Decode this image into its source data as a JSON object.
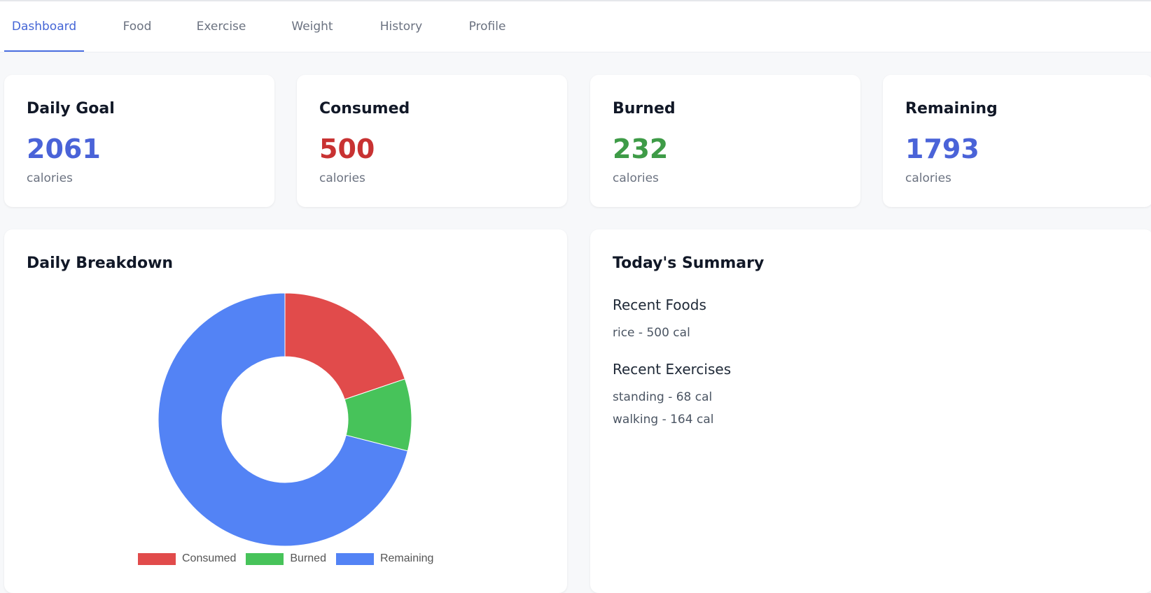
{
  "nav": {
    "tabs": [
      {
        "label": "Dashboard",
        "active": true
      },
      {
        "label": "Food",
        "active": false
      },
      {
        "label": "Exercise",
        "active": false
      },
      {
        "label": "Weight",
        "active": false
      },
      {
        "label": "History",
        "active": false
      },
      {
        "label": "Profile",
        "active": false
      }
    ]
  },
  "stats": [
    {
      "title": "Daily Goal",
      "value": "2061",
      "unit": "calories",
      "color": "#4a63d8"
    },
    {
      "title": "Consumed",
      "value": "500",
      "unit": "calories",
      "color": "#c83232"
    },
    {
      "title": "Burned",
      "value": "232",
      "unit": "calories",
      "color": "#3e9b47"
    },
    {
      "title": "Remaining",
      "value": "1793",
      "unit": "calories",
      "color": "#4a63d8"
    }
  ],
  "breakdown": {
    "title": "Daily Breakdown"
  },
  "chart_data": {
    "type": "pie",
    "variant": "doughnut",
    "categories": [
      "Consumed",
      "Burned",
      "Remaining"
    ],
    "values": [
      500,
      232,
      1793
    ],
    "colors": [
      "#e14b4b",
      "#47c35a",
      "#5383f5"
    ],
    "legend": "bottom"
  },
  "summary": {
    "title": "Today's Summary",
    "foods_title": "Recent Foods",
    "foods": [
      "rice - 500 cal"
    ],
    "exercises_title": "Recent Exercises",
    "exercises": [
      "standing - 68 cal",
      "walking - 164 cal"
    ]
  }
}
